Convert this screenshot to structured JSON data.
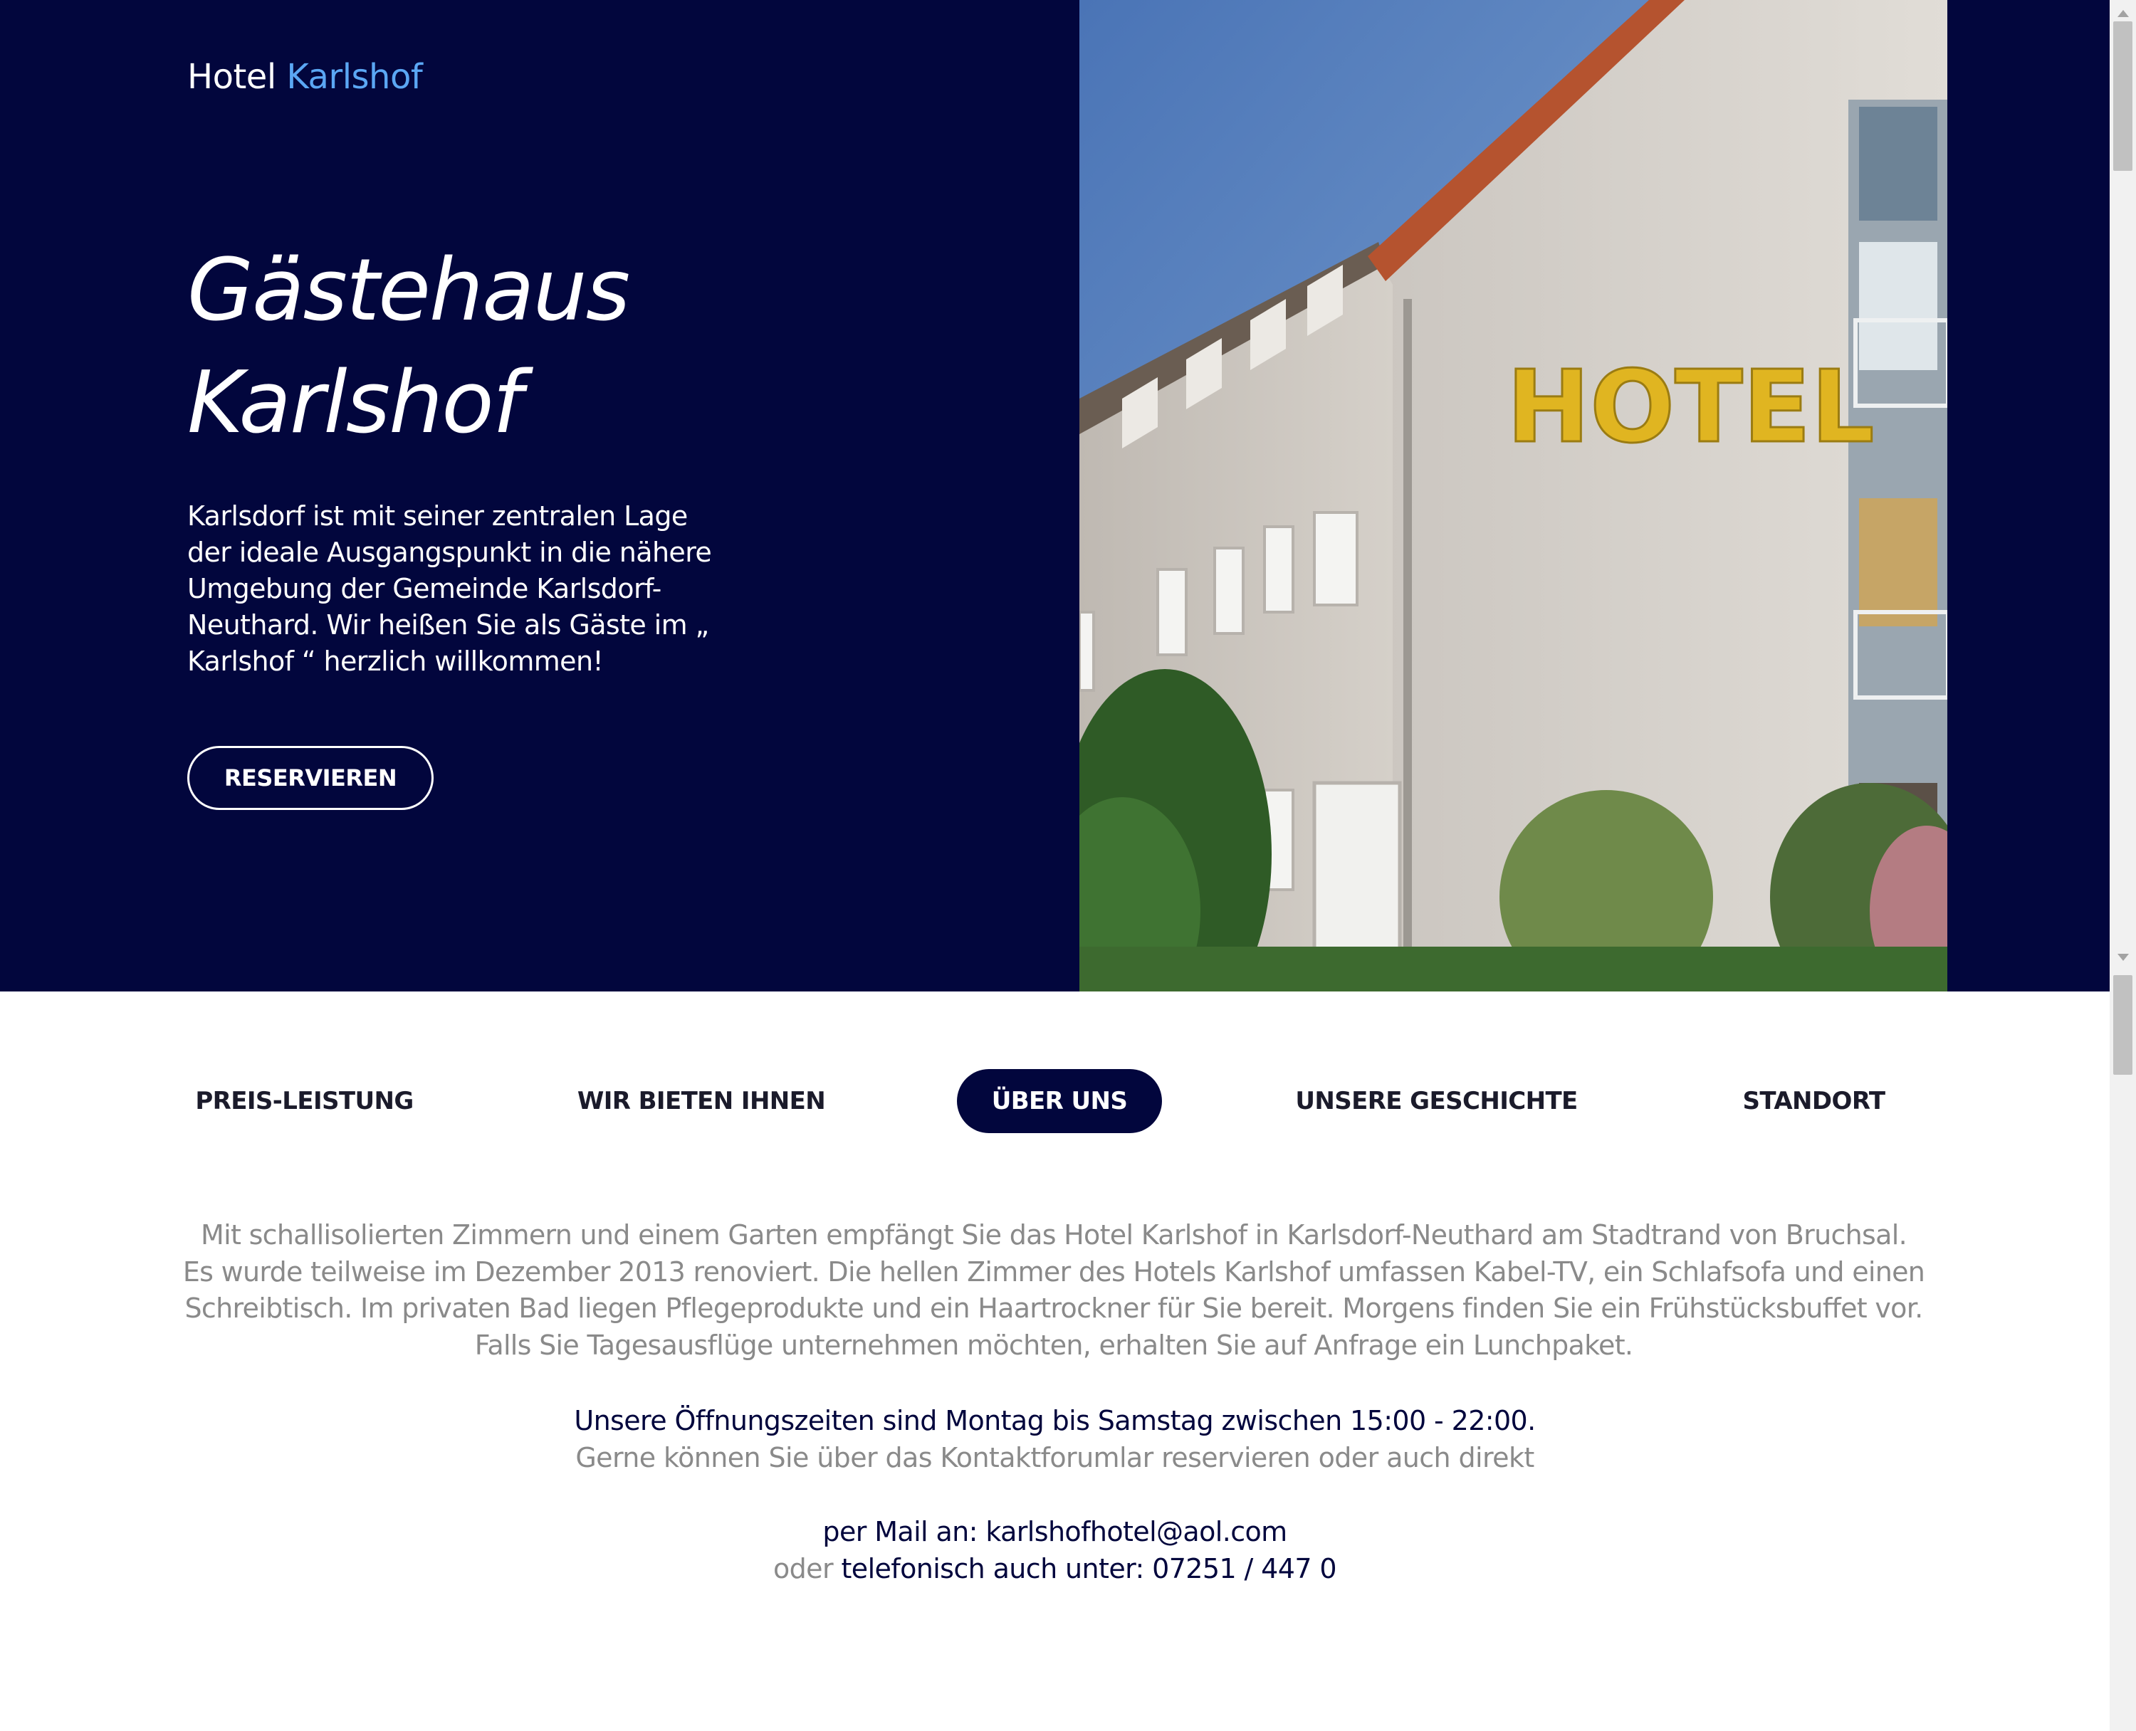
{
  "brand": {
    "first": "Hotel",
    "second": "Karlshof"
  },
  "hero": {
    "title_line1": "Gästehaus",
    "title_line2": "Karlshof",
    "text": "Karlsdorf ist mit seiner zentralen Lage der ideale Ausgangspunkt in die nähere Umgebung der Gemeinde Karlsdorf-Neuthard. Wir heißen Sie als Gäste im „ Karlshof “ herzlich willkommen!",
    "button_label": "RESERVIEREN",
    "photo_sign": "HOTEL"
  },
  "tabs": [
    {
      "label": "PREIS-LEISTUNG",
      "active": false
    },
    {
      "label": "WIR BIETEN IHNEN",
      "active": false
    },
    {
      "label": "ÜBER UNS",
      "active": true
    },
    {
      "label": "UNSERE GESCHICHTE",
      "active": false
    },
    {
      "label": "STANDORT",
      "active": false
    }
  ],
  "about": {
    "lines": [
      "Mit schallisolierten Zimmern und einem Garten empfängt Sie das Hotel Karlshof in Karlsdorf-Neuthard am Stadtrand von Bruchsal.",
      "Es wurde teilweise im Dezember 2013 renoviert. Die hellen Zimmer des Hotels Karlshof umfassen Kabel-TV, ein Schlafsofa und einen",
      "Schreibtisch. Im privaten Bad liegen Pflegeprodukte und ein Haartrockner für Sie bereit. Morgens finden Sie ein Frühstücksbuffet vor.",
      "Falls Sie Tagesausflüge unternehmen möchten, erhalten Sie auf Anfrage ein Lunchpaket."
    ],
    "hours": "Unsere Öffnungszeiten sind Montag bis Samstag zwischen 15:00 - 22:00.",
    "reserve_note": "Gerne können Sie über das Kontaktforumlar reservieren oder auch direkt",
    "mail": "per Mail an: karlshofhotel@aol.com",
    "phone_prefix": "oder",
    "phone": "telefonisch auch unter: 07251 / 447 0"
  },
  "colors": {
    "navy": "#02063d",
    "accent": "#5ba7f4",
    "muted_text": "#8a8a8a"
  }
}
